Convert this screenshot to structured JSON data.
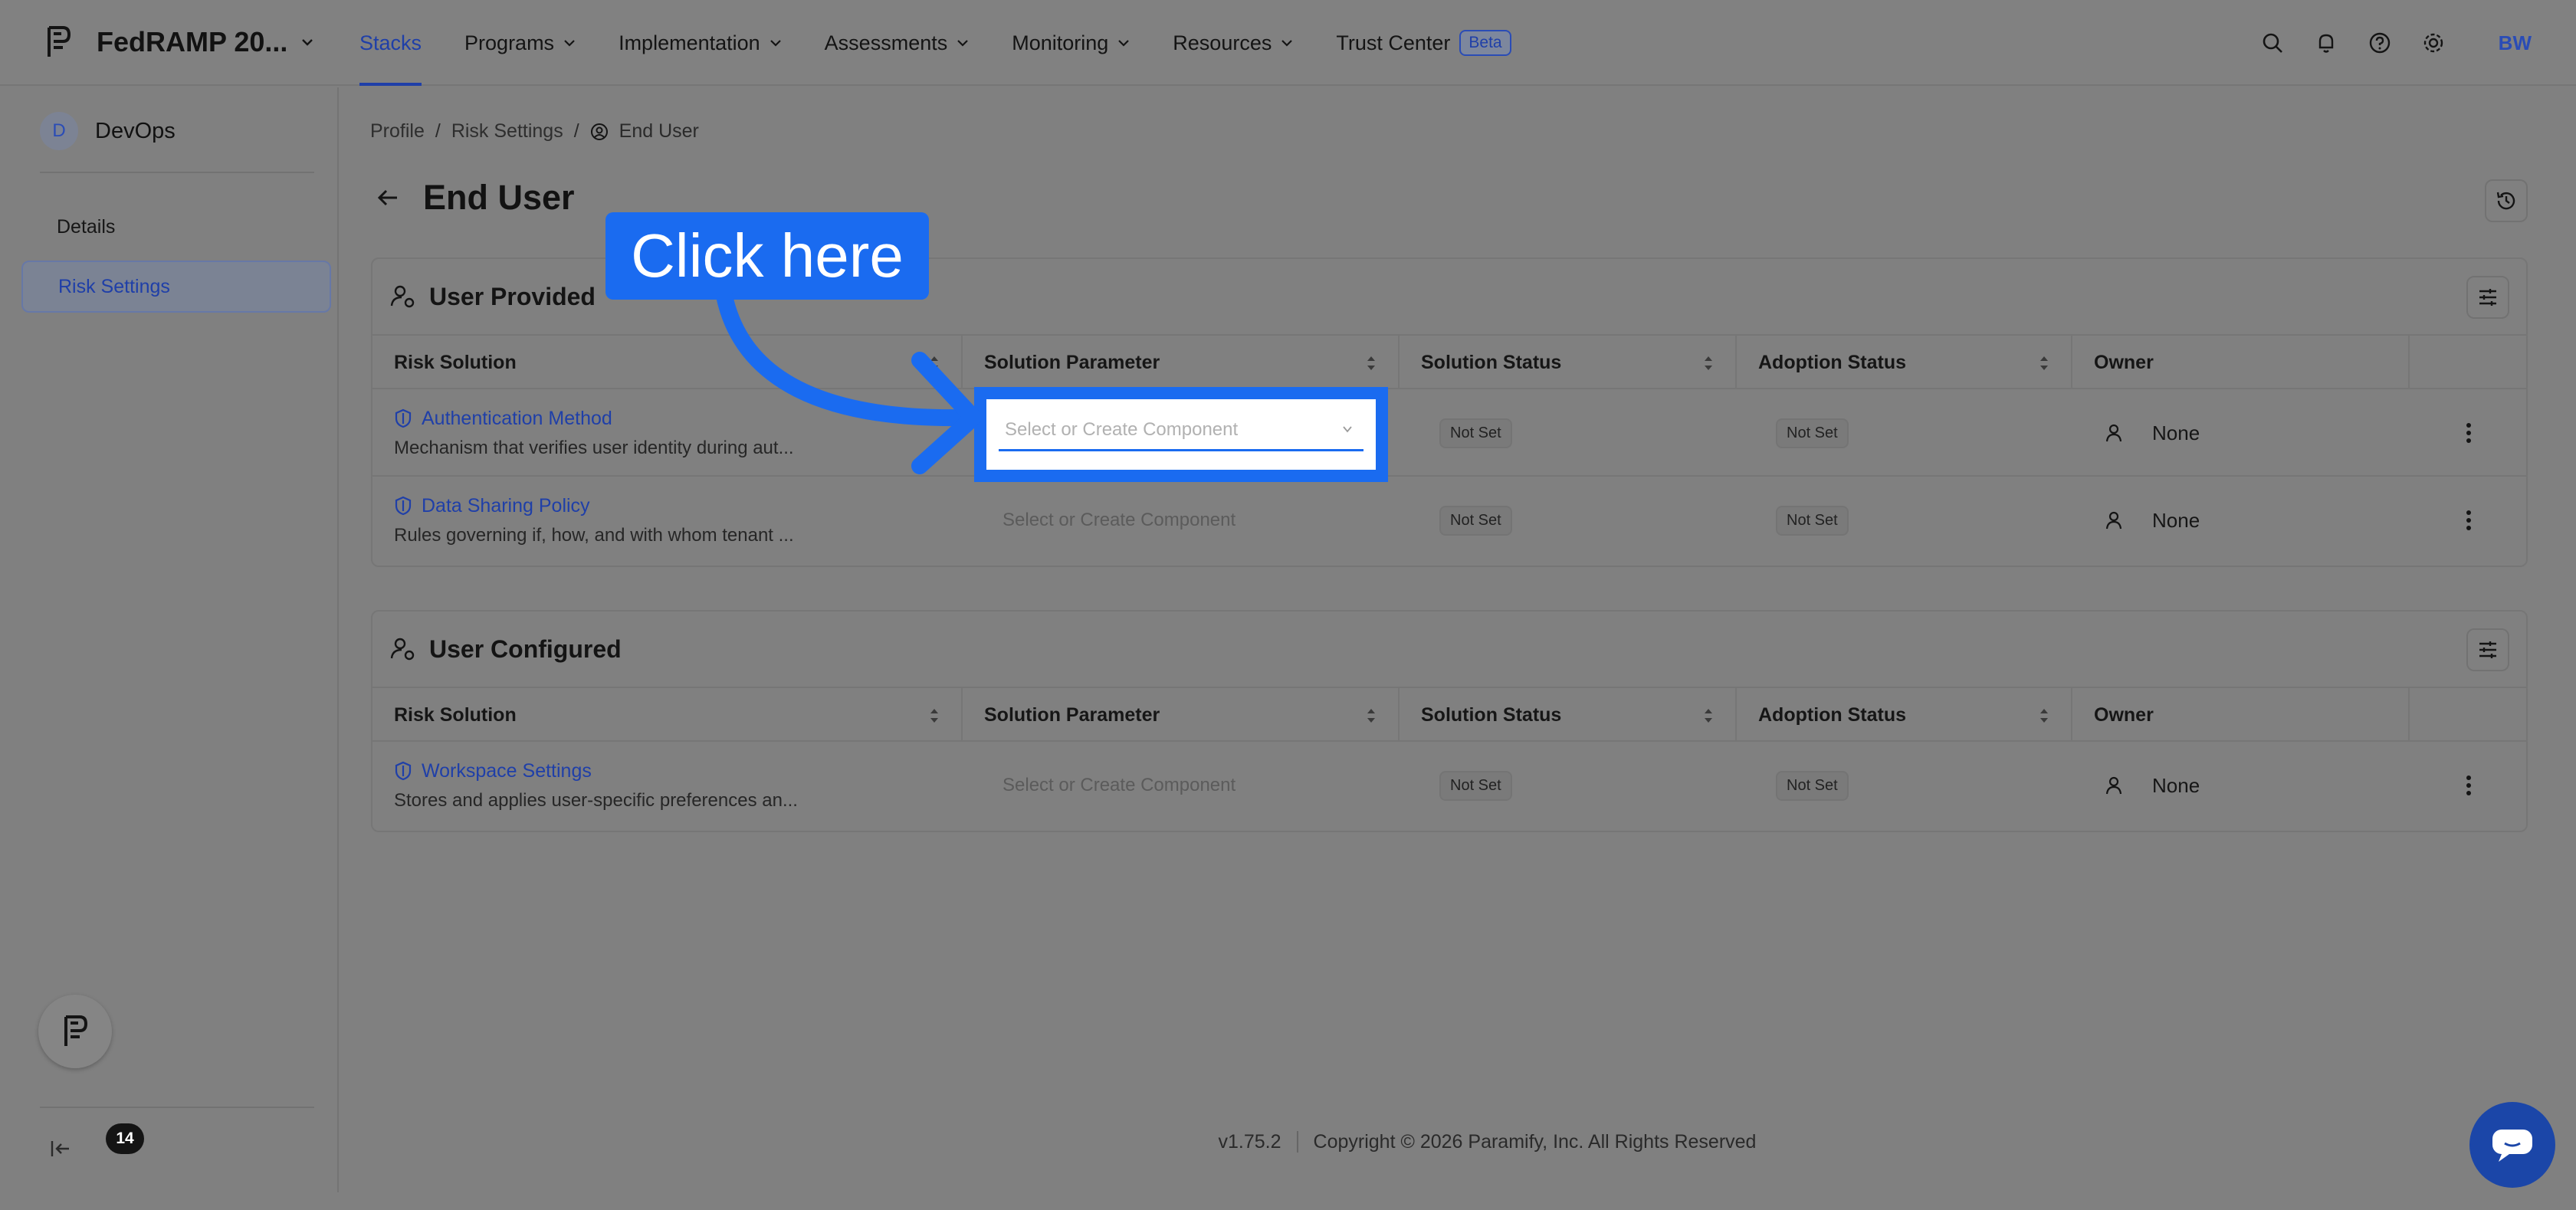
{
  "topnav": {
    "org_name": "FedRAMP 20...",
    "items": [
      {
        "label": "Stacks"
      },
      {
        "label": "Programs"
      },
      {
        "label": "Implementation"
      },
      {
        "label": "Assessments"
      },
      {
        "label": "Monitoring"
      },
      {
        "label": "Resources"
      },
      {
        "label": "Trust Center"
      }
    ],
    "beta_badge": "Beta",
    "user_initials": "BW"
  },
  "sidebar": {
    "workspace_initial": "D",
    "workspace_name": "DevOps",
    "items": [
      {
        "label": "Details"
      },
      {
        "label": "Risk Settings"
      }
    ],
    "helper_count": "14"
  },
  "breadcrumb": {
    "items": [
      "Profile",
      "Risk Settings",
      "End User"
    ],
    "separator": "/"
  },
  "page": {
    "title": "End User"
  },
  "headers": {
    "risk_solution": "Risk Solution",
    "solution_parameter": "Solution Parameter",
    "solution_status": "Solution Status",
    "adoption_status": "Adoption Status",
    "owner": "Owner"
  },
  "sections": [
    {
      "title": "User Provided",
      "rows": [
        {
          "name": "Authentication Method",
          "desc": "Mechanism that verifies user identity during aut...",
          "param_placeholder": "Select or Create Component",
          "solution_status": "Not Set",
          "adoption_status": "Not Set",
          "owner": "None"
        },
        {
          "name": "Data Sharing Policy",
          "desc": "Rules governing if, how, and with whom tenant ...",
          "param_placeholder": "Select or Create Component",
          "solution_status": "Not Set",
          "adoption_status": "Not Set",
          "owner": "None"
        }
      ]
    },
    {
      "title": "User Configured",
      "rows": [
        {
          "name": "Workspace Settings",
          "desc": "Stores and applies user-specific preferences an...",
          "param_placeholder": "Select or Create Component",
          "solution_status": "Not Set",
          "adoption_status": "Not Set",
          "owner": "None"
        }
      ]
    }
  ],
  "callout": {
    "text": "Click here"
  },
  "footer": {
    "version": "v1.75.2",
    "copyright": "Copyright © 2026 Paramify, Inc. All Rights Reserved"
  },
  "colors": {
    "accent": "#1a6bf0",
    "link": "#1f3fa8",
    "overlay": "#808080"
  }
}
